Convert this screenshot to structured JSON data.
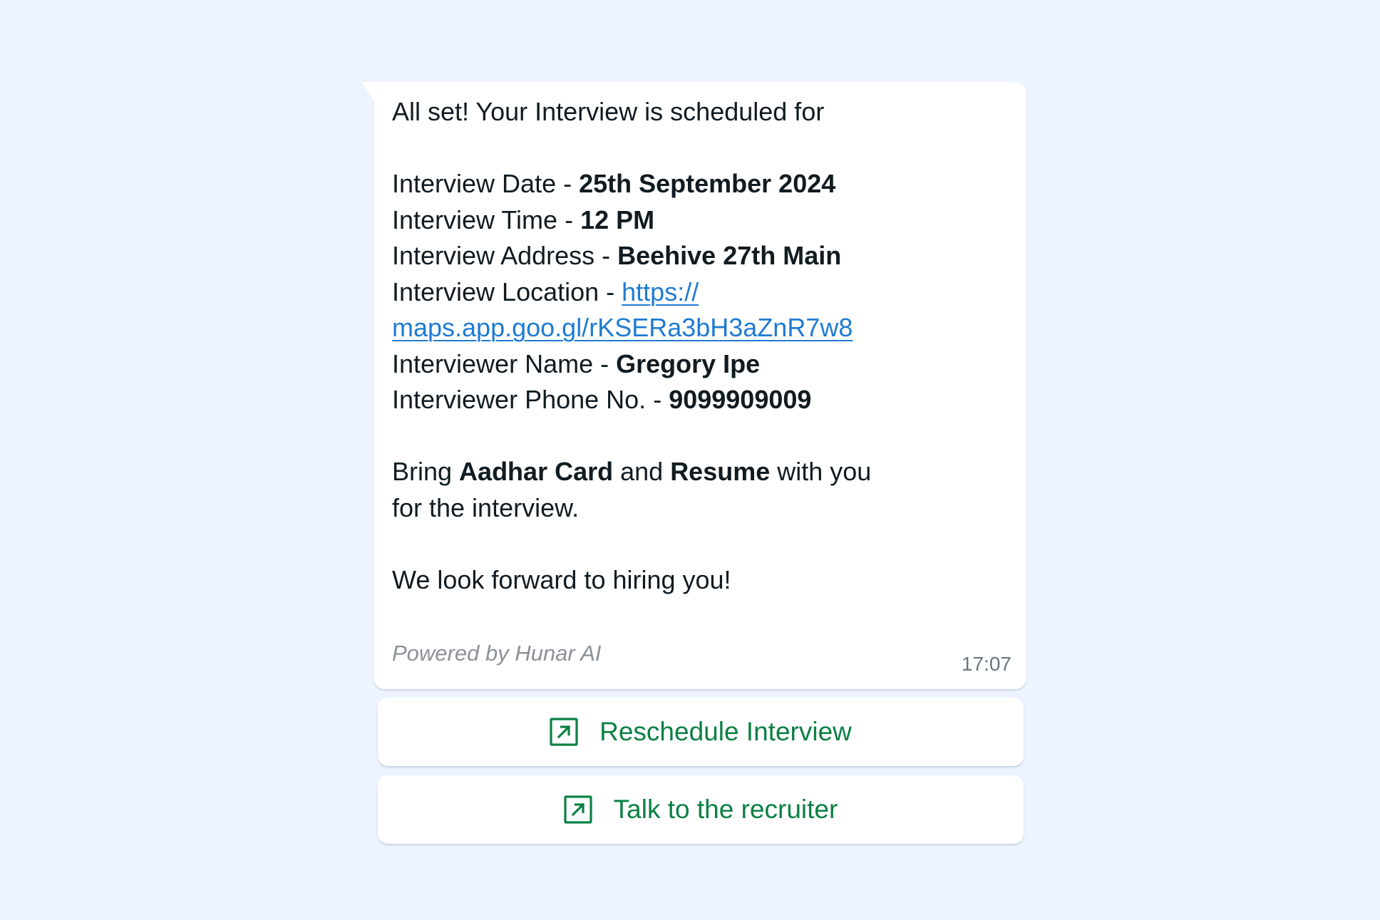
{
  "message": {
    "intro": "All set! Your Interview is scheduled for",
    "date_label": "Interview Date - ",
    "date_value": "25th September 2024",
    "time_label": "Interview Time - ",
    "time_value": "12 PM",
    "address_label": "Interview Address - ",
    "address_value": "Beehive 27th Main",
    "location_label": "Interview Location - ",
    "location_link_part1": "https://",
    "location_link_part2": "maps.app.goo.gl/rKSERa3bH3aZnR7w8",
    "interviewer_name_label": "Interviewer Name - ",
    "interviewer_name_value": "Gregory Ipe",
    "interviewer_phone_label": "Interviewer Phone No. - ",
    "interviewer_phone_value": "9099909009",
    "bring_prefix": "Bring ",
    "bring_item1": "Aadhar Card",
    "bring_and": " and ",
    "bring_item2": "Resume",
    "bring_suffix": " with you",
    "bring_line2": "for the interview.",
    "closing": "We look forward to hiring you!",
    "footer": "Powered by Hunar AI",
    "timestamp": "17:07"
  },
  "buttons": {
    "reschedule": {
      "label": "Reschedule Interview",
      "icon": "external-link-icon"
    },
    "talk": {
      "label": "Talk to the recruiter",
      "icon": "external-link-icon"
    }
  },
  "colors": {
    "background": "#edf4ff",
    "bubble": "#ffffff",
    "text": "#111b21",
    "link": "#1f7bd3",
    "button_text": "#0b8043",
    "footer": "#8b9197",
    "timestamp": "#667781"
  }
}
